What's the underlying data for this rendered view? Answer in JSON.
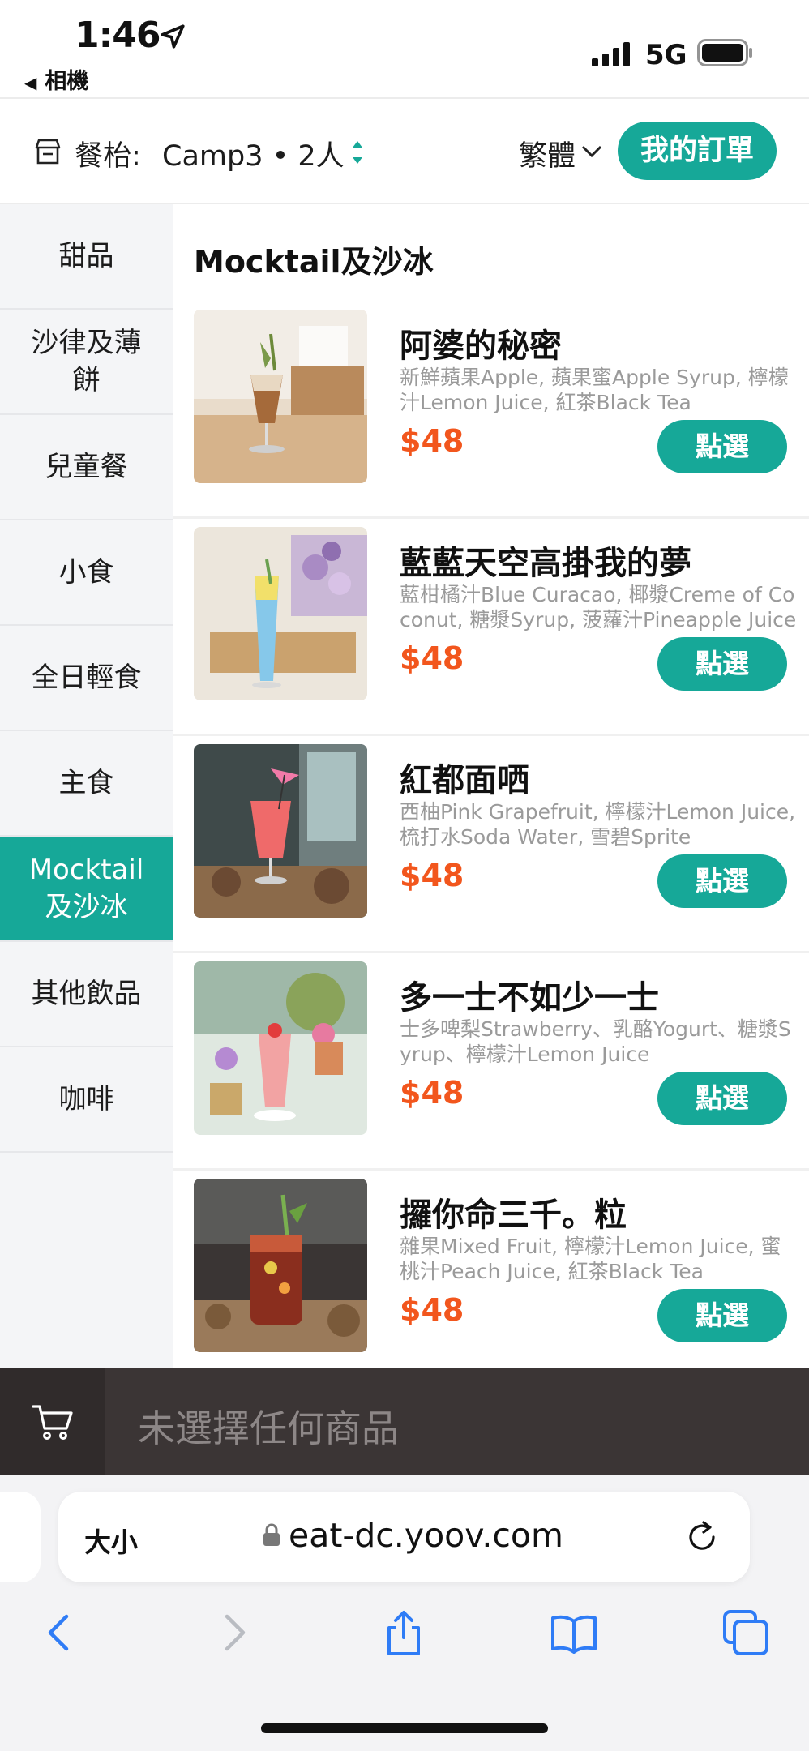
{
  "status_bar": {
    "time": "1:46",
    "back_label": "相機",
    "network": "5G"
  },
  "header": {
    "table_label": "餐枱:",
    "table_info": "Camp3 • 2人",
    "language": "繁體",
    "my_order_label": "我的訂單"
  },
  "sidebar": {
    "items": [
      {
        "label": "甜品",
        "active": false
      },
      {
        "label": "沙律及薄餅",
        "active": false
      },
      {
        "label": "兒童餐",
        "active": false
      },
      {
        "label": "小食",
        "active": false
      },
      {
        "label": "全日輕食",
        "active": false
      },
      {
        "label": "主食",
        "active": false
      },
      {
        "label": "Mocktail及沙冰",
        "active": true
      },
      {
        "label": "其他飲品",
        "active": false
      },
      {
        "label": "咖啡",
        "active": false
      }
    ]
  },
  "main": {
    "section_title": "Mocktail及沙冰",
    "products": [
      {
        "name": "阿婆的秘密",
        "desc": "新鮮蘋果Apple, 蘋果蜜Apple Syrup, 檸檬汁Lemon Juice, 紅茶Black Tea",
        "price": "$48",
        "button": "點選"
      },
      {
        "name": "藍藍天空高掛我的夢",
        "desc": "藍柑橘汁Blue Curacao, 椰漿Creme of Coconut, 糖漿Syrup, 菠蘿汁Pineapple Juice",
        "price": "$48",
        "button": "點選"
      },
      {
        "name": "紅都面哂",
        "desc": "西柚Pink Grapefruit, 檸檬汁Lemon Juice, 梳打水Soda Water, 雪碧Sprite",
        "price": "$48",
        "button": "點選"
      },
      {
        "name": "多一士不如少一士",
        "desc": "士多啤梨Strawberry、乳酪Yogurt、糖漿Syrup、檸檬汁Lemon Juice",
        "price": "$48",
        "button": "點選"
      },
      {
        "name": "攞你命三千。粒",
        "desc": "雜果Mixed Fruit, 檸檬汁Lemon Juice, 蜜桃汁Peach Juice, 紅茶Black Tea",
        "price": "$48",
        "button": "點選"
      }
    ]
  },
  "cart": {
    "empty_text": "未選擇任何商品"
  },
  "safari": {
    "text_size_label": "大小",
    "url": "eat-dc.yoov.com"
  },
  "colors": {
    "accent": "#16a898",
    "price": "#f2561d",
    "cart_bar": "#3b3535",
    "ios_blue": "#2f7cf6"
  }
}
